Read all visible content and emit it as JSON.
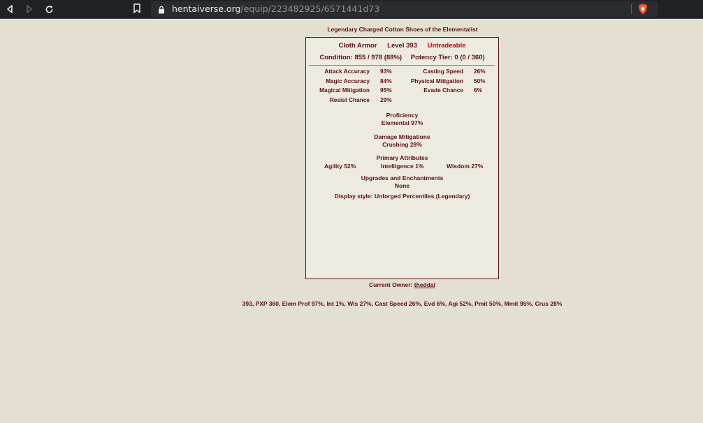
{
  "browser": {
    "url_host": "hentaiverse.org",
    "url_path": "/equip/223482925/6571441d73"
  },
  "item": {
    "name": "Legendary Charged Cotton Shoes of the Elementalist",
    "type": "Cloth Armor",
    "level": "Level 393",
    "tradeable": "Untradeable",
    "condition": "Condition: 855 / 978 (88%)",
    "potency": "Potency Tier: 0 (0 / 360)"
  },
  "stats_left": [
    {
      "name": "Attack Accuracy",
      "value": "93%"
    },
    {
      "name": "Magic Accuracy",
      "value": "84%"
    },
    {
      "name": "Magical Mitigation",
      "value": "95%"
    },
    {
      "name": "Resist Chance",
      "value": "29%"
    }
  ],
  "stats_right": [
    {
      "name": "Casting Speed",
      "value": "26%"
    },
    {
      "name": "Physical Mitigation",
      "value": "50%"
    },
    {
      "name": "Evade Chance",
      "value": "6%"
    }
  ],
  "proficiency": {
    "title": "Proficiency",
    "value": "Elemental 97%"
  },
  "damage_mitigations": {
    "title": "Damage Mitigations",
    "value": "Crushing 28%"
  },
  "primary_attributes": {
    "title": "Primary Attributes",
    "agility": "Agility 52%",
    "intelligence": "Intelligence 1%",
    "wisdom": "Wisdom 27%"
  },
  "upgrades": {
    "title": "Upgrades and Enchantments",
    "value": "None"
  },
  "display_style": "Display style: Unforged Percentiles (Legendary)",
  "owner": {
    "label": "Current Owner:",
    "name": "theddal"
  },
  "summary": "393, PXP 360, Elem Prof 97%, Int 1%, Wis 27%, Cast Speed 26%, Evd 6%, Agi 52%, Pmit 50%, Mmit 95%, Crus 28%",
  "colors": {
    "background": "#e3e0d1",
    "text": "#5c0d11",
    "untradeable": "#cc0000",
    "panel": "#edebdf"
  }
}
